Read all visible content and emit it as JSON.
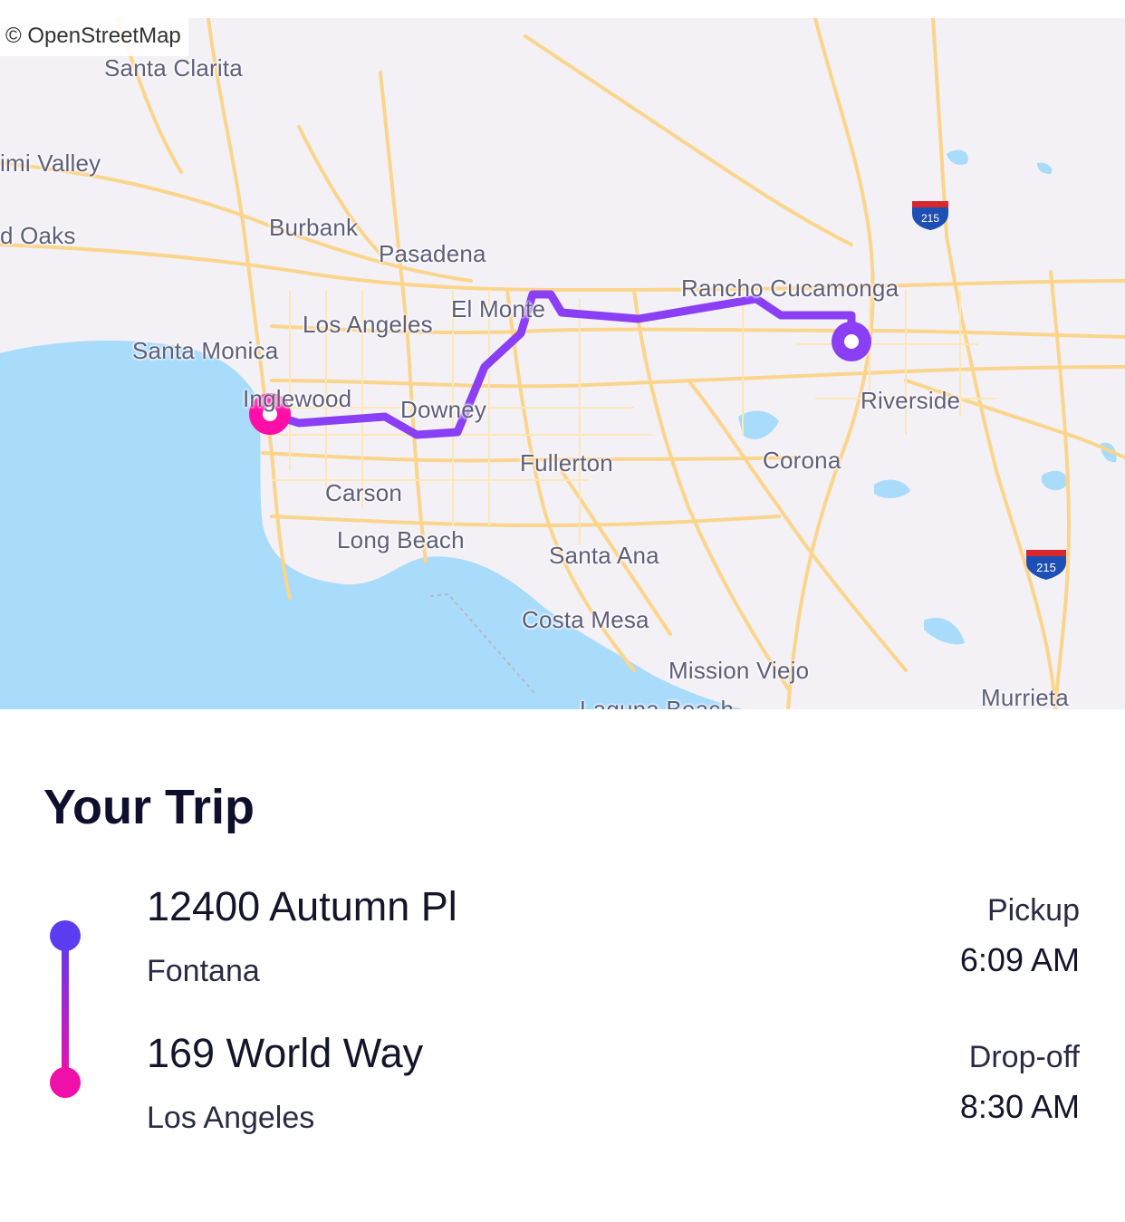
{
  "map": {
    "attribution": "© OpenStreetMap",
    "cities": [
      {
        "name": "Santa Clarita"
      },
      {
        "name": "imi Valley"
      },
      {
        "name": "d Oaks"
      },
      {
        "name": "Burbank"
      },
      {
        "name": "Pasadena"
      },
      {
        "name": "Rancho Cucamonga"
      },
      {
        "name": "El Monte"
      },
      {
        "name": "Los Angeles"
      },
      {
        "name": "Santa Monica"
      },
      {
        "name": "Inglewood"
      },
      {
        "name": "Downey"
      },
      {
        "name": "Riverside"
      },
      {
        "name": "Fullerton"
      },
      {
        "name": "Corona"
      },
      {
        "name": "Carson"
      },
      {
        "name": "Long Beach"
      },
      {
        "name": "Santa Ana"
      },
      {
        "name": "Costa Mesa"
      },
      {
        "name": "Mission Viejo"
      },
      {
        "name": "Murrieta"
      },
      {
        "name": "Laguna Beach"
      }
    ],
    "shields": [
      "215",
      "215"
    ],
    "colors": {
      "route": "#8a3ff5",
      "pickup_marker": "#8a3ff5",
      "dropoff_marker": "#ff0fa8",
      "water": "#a8dcfa",
      "roads": "#fbd58c"
    }
  },
  "trip": {
    "title": "Your Trip",
    "pickup": {
      "address": "12400 Autumn Pl",
      "city": "Fontana",
      "label": "Pickup",
      "time": "6:09 AM",
      "color": "#5b3cf0"
    },
    "dropoff": {
      "address": "169 World Way",
      "city": "Los Angeles",
      "label": "Drop-off",
      "time": "8:30 AM",
      "color": "#f00fa8"
    }
  }
}
